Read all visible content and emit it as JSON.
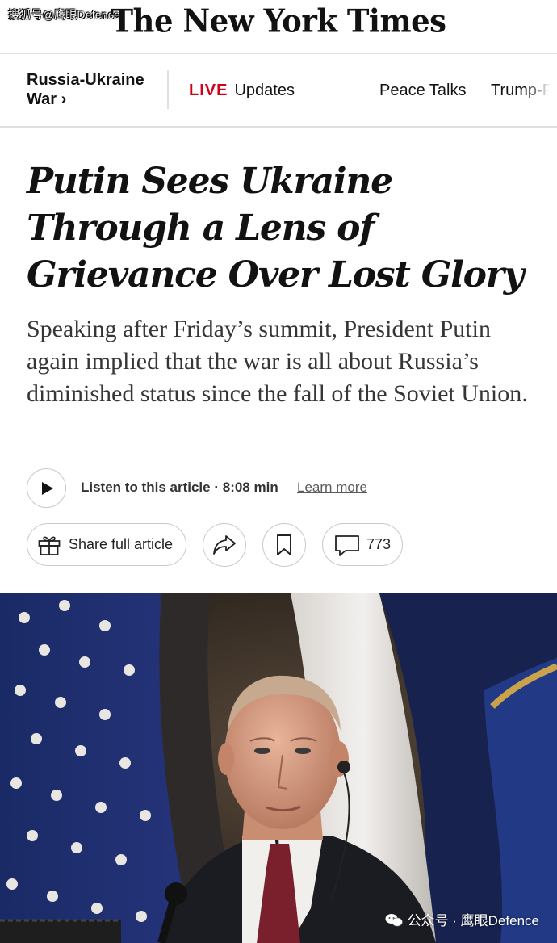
{
  "watermark_top": "搜狐号@鹰眼Defence",
  "masthead": {
    "logo": "The New York Times"
  },
  "section_bar": {
    "section_line1": "Russia-Ukraine",
    "section_line2": "War ›",
    "live_badge": "LIVE",
    "live_label": "Updates",
    "nav_peace": "Peace Talks",
    "nav_trump": "Trump-P"
  },
  "article": {
    "headline": "Putin Sees Ukraine Through a Lens of Grievance Over Lost Glory",
    "summary": "Speaking after Friday’s summit, President Putin again implied that the war is all about Russia’s diminished status since the fall of the Soviet Union."
  },
  "audio": {
    "listen_label": "Listen to this article",
    "separator": "·",
    "duration": "8:08 min",
    "learn_more": "Learn more"
  },
  "actions": {
    "share_full_label": "Share full article",
    "comment_count": "773"
  },
  "photo": {
    "watermark": "公众号 · 鹰眼Defence"
  },
  "colors": {
    "live_red": "#d0021b",
    "text": "#121212",
    "summary_text": "#363636",
    "border": "#c9c9c9"
  },
  "icons": [
    "play-icon",
    "gift-icon",
    "share-arrow-icon",
    "bookmark-icon",
    "comment-icon",
    "wechat-icon"
  ]
}
